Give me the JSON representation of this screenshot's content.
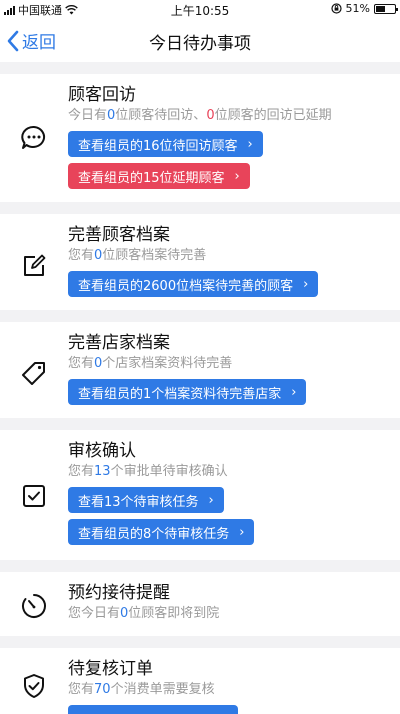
{
  "status": {
    "carrier": "中国联通",
    "time": "上午10:55",
    "battery": "51%",
    "battery_level": 0.51
  },
  "nav": {
    "back_label": "返回",
    "title": "今日待办事项"
  },
  "cards": [
    {
      "title": "顾客回访",
      "desc_parts": [
        "今日有",
        "0",
        "位顾客待回访、",
        "0",
        "位顾客的回访已延期"
      ],
      "buttons": [
        "查看组员的16位待回访顾客",
        "查看组员的15位延期顾客"
      ]
    },
    {
      "title": "完善顾客档案",
      "desc_parts": [
        "您有",
        "0",
        "位顾客档案待完善"
      ],
      "buttons": [
        "查看组员的2600位档案待完善的顾客"
      ]
    },
    {
      "title": "完善店家档案",
      "desc_parts": [
        "您有",
        "0",
        "个店家档案资料待完善"
      ],
      "buttons": [
        "查看组员的1个档案资料待完善店家"
      ]
    },
    {
      "title": "审核确认",
      "desc_parts": [
        "您有",
        "13",
        "个审批单待审核确认"
      ],
      "buttons": [
        "查看13个待审核任务",
        "查看组员的8个待审核任务"
      ]
    },
    {
      "title": "预约接待提醒",
      "desc_parts": [
        "您今日有",
        "0",
        "位顾客即将到院"
      ]
    },
    {
      "title": "待复核订单",
      "desc_parts": [
        "您有",
        "70",
        "个消费单需要复核"
      ]
    }
  ],
  "colors": {
    "accent": "#2f7ae5",
    "danger": "#e8445a"
  },
  "icons": [
    "message-icon",
    "edit-icon",
    "tag-icon",
    "checkbox-icon",
    "timer-icon",
    "shield-check-icon"
  ]
}
